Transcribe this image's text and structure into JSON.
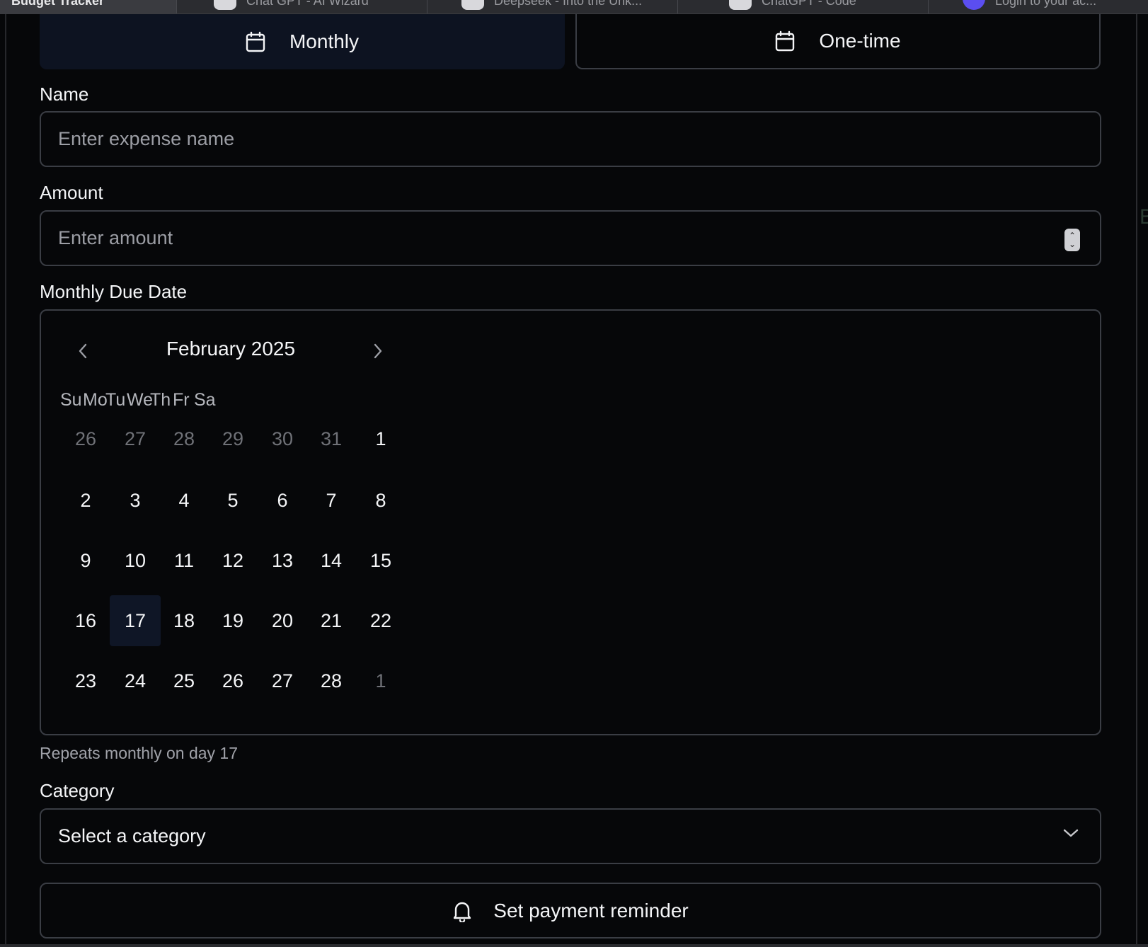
{
  "browser": {
    "tabs": [
      {
        "label": "Budget Tracker",
        "active": true,
        "icon": "none"
      },
      {
        "label": "Chat GPT - AI Wizard",
        "active": false,
        "icon": "openai-icon"
      },
      {
        "label": "Deepseek - Into the Unk...",
        "active": false,
        "icon": "app-icon"
      },
      {
        "label": "ChatGPT - Code",
        "active": false,
        "icon": "openai-icon"
      },
      {
        "label": "Login to your ac...",
        "active": false,
        "icon": "round-app-icon"
      }
    ]
  },
  "toggle": {
    "monthly_label": "Monthly",
    "onetime_label": "One-time",
    "selected": "Monthly"
  },
  "name_field": {
    "label": "Name",
    "placeholder": "Enter expense name",
    "value": ""
  },
  "amount_field": {
    "label": "Amount",
    "placeholder": "Enter amount",
    "value": ""
  },
  "due_date": {
    "label": "Monthly Due Date",
    "calendar": {
      "month_label": "February 2025",
      "weekdays": [
        "Su",
        "Mo",
        "Tu",
        "We",
        "Th",
        "Fr",
        "Sa"
      ],
      "weeks": [
        [
          {
            "d": "26",
            "outside": true
          },
          {
            "d": "27",
            "outside": true
          },
          {
            "d": "28",
            "outside": true
          },
          {
            "d": "29",
            "outside": true
          },
          {
            "d": "30",
            "outside": true
          },
          {
            "d": "31",
            "outside": true
          },
          {
            "d": "1",
            "outside": false
          }
        ],
        [
          {
            "d": "2"
          },
          {
            "d": "3"
          },
          {
            "d": "4"
          },
          {
            "d": "5"
          },
          {
            "d": "6"
          },
          {
            "d": "7"
          },
          {
            "d": "8"
          }
        ],
        [
          {
            "d": "9"
          },
          {
            "d": "10"
          },
          {
            "d": "11"
          },
          {
            "d": "12"
          },
          {
            "d": "13"
          },
          {
            "d": "14"
          },
          {
            "d": "15"
          }
        ],
        [
          {
            "d": "16"
          },
          {
            "d": "17",
            "selected": true
          },
          {
            "d": "18"
          },
          {
            "d": "19"
          },
          {
            "d": "20"
          },
          {
            "d": "21"
          },
          {
            "d": "22"
          }
        ],
        [
          {
            "d": "23"
          },
          {
            "d": "24"
          },
          {
            "d": "25"
          },
          {
            "d": "26"
          },
          {
            "d": "27"
          },
          {
            "d": "28"
          },
          {
            "d": "1",
            "outside": true
          }
        ]
      ]
    },
    "helper": "Repeats monthly on day 17"
  },
  "category": {
    "label": "Category",
    "placeholder": "Select a category"
  },
  "reminder_button": {
    "label": "Set payment reminder"
  },
  "colors": {
    "background": "#060709",
    "accent_selected": "#0d1321",
    "border": "#3a3d44",
    "muted_text": "#9c9ea5"
  }
}
